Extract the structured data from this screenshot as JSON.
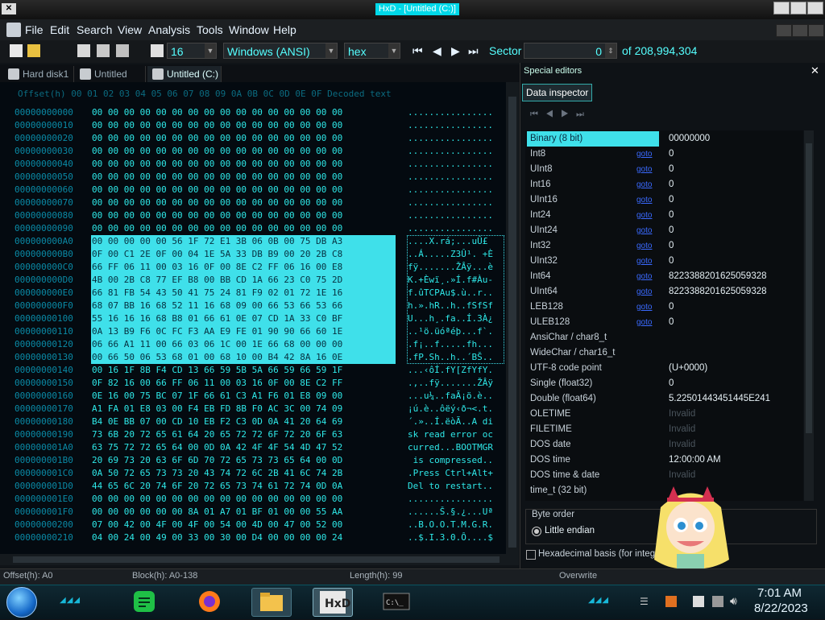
{
  "window": {
    "title": "HxD - [Untitled (C:)]",
    "app_icon": "hxd-icon"
  },
  "menu": {
    "items": [
      "File",
      "Edit",
      "Search",
      "View",
      "Analysis",
      "Tools",
      "Window",
      "Help"
    ]
  },
  "toolbar": {
    "bytes_per_row": "16",
    "encoding": "Windows (ANSI)",
    "display_mode": "hex",
    "sector_label": "Sector",
    "sector_value": "0",
    "sector_total": "of 208,994,304"
  },
  "tabs": [
    {
      "label": "Hard disk1",
      "active": false
    },
    {
      "label": "Untitled (C:)",
      "active": false
    },
    {
      "label": "Untitled (C:)",
      "active": true
    }
  ],
  "hex_view": {
    "header": "Offset(h)  00 01 02 03 04 05 06 07 08 09 0A 0B 0C 0D 0E 0F  Decoded text",
    "rows": [
      {
        "off": "00000000000",
        "hex": "00 00 00 00 00 00 00 00 00 00 00 00 00 00 00 00",
        "txt": "................",
        "sel": false
      },
      {
        "off": "00000000010",
        "hex": "00 00 00 00 00 00 00 00 00 00 00 00 00 00 00 00",
        "txt": "................",
        "sel": false
      },
      {
        "off": "00000000020",
        "hex": "00 00 00 00 00 00 00 00 00 00 00 00 00 00 00 00",
        "txt": "................",
        "sel": false
      },
      {
        "off": "00000000030",
        "hex": "00 00 00 00 00 00 00 00 00 00 00 00 00 00 00 00",
        "txt": "................",
        "sel": false
      },
      {
        "off": "00000000040",
        "hex": "00 00 00 00 00 00 00 00 00 00 00 00 00 00 00 00",
        "txt": "................",
        "sel": false
      },
      {
        "off": "00000000050",
        "hex": "00 00 00 00 00 00 00 00 00 00 00 00 00 00 00 00",
        "txt": "................",
        "sel": false
      },
      {
        "off": "00000000060",
        "hex": "00 00 00 00 00 00 00 00 00 00 00 00 00 00 00 00",
        "txt": "................",
        "sel": false
      },
      {
        "off": "00000000070",
        "hex": "00 00 00 00 00 00 00 00 00 00 00 00 00 00 00 00",
        "txt": "................",
        "sel": false
      },
      {
        "off": "00000000080",
        "hex": "00 00 00 00 00 00 00 00 00 00 00 00 00 00 00 00",
        "txt": "................",
        "sel": false
      },
      {
        "off": "00000000090",
        "hex": "00 00 00 00 00 00 00 00 00 00 00 00 00 00 00 00",
        "txt": "................",
        "sel": false
      },
      {
        "off": "000000000A0",
        "hex": "00 00 00 00 00 56 1F 72 E1 3B 06 0B 00 75 DB A3",
        "txt": "....X.rá;...uÛ£",
        "sel": true
      },
      {
        "off": "000000000B0",
        "hex": "0F 00 C1 2E 0F 00 04 1E 5A 33 DB B9 00 20 2B C8",
        "txt": "..Á.....Z3Û¹. +È",
        "sel": true
      },
      {
        "off": "000000000C0",
        "hex": "66 FF 06 11 00 03 16 0F 00 8E C2 FF 06 16 00 E8",
        "txt": "fÿ.......ŽÂÿ...è",
        "sel": true
      },
      {
        "off": "000000000D0",
        "hex": "4B 00 2B C8 77 EF B8 00 BB CD 1A 66 23 C0 75 2D",
        "txt": "K.+Èwï¸.»Í.f#Àu-",
        "sel": true
      },
      {
        "off": "000000000E0",
        "hex": "66 81 FB 54 43 50 41 75 24 81 F9 02 01 72 1E 16",
        "txt": "f.ûTCPAu$.ù..r..",
        "sel": true
      },
      {
        "off": "000000000F0",
        "hex": "68 07 BB 16 68 52 11 16 68 09 00 66 53 66 53 66",
        "txt": "h.».hR..h..fSfSf",
        "sel": true
      },
      {
        "off": "00000000100",
        "hex": "55 16 16 16 68 B8 01 66 61 0E 07 CD 1A 33 C0 BF",
        "txt": "U...h¸.fa..Í.3À¿",
        "sel": true
      },
      {
        "off": "00000000110",
        "hex": "0A 13 B9 F6 0C FC F3 AA E9 FE 01 90 90 66 60 1E",
        "txt": "..¹ö.üóªéþ...f`.",
        "sel": true
      },
      {
        "off": "00000000120",
        "hex": "06 66 A1 11 00 66 03 06 1C 00 1E 66 68 00 00 00",
        "txt": ".f¡..f.....fh...",
        "sel": true
      },
      {
        "off": "00000000130",
        "hex": "00 66 50 06 53 68 01 00 68 10 00 B4 42 8A 16 0E",
        "txt": ".fP.Sh..h..´BŠ..",
        "sel": true
      },
      {
        "off": "00000000140",
        "hex": "00 16 1F 8B F4 CD 13 66 59 5B 5A 66 59 66 59 1F",
        "txt": "...‹ôÍ.fY[ZfYfY.",
        "sel": false
      },
      {
        "off": "00000000150",
        "hex": "0F 82 16 00 66 FF 06 11 00 03 16 0F 00 8E C2 FF",
        "txt": ".,..fÿ.......ŽÂÿ",
        "sel": false
      },
      {
        "off": "00000000160",
        "hex": "0E 16 00 75 BC 07 1F 66 61 C3 A1 F6 01 E8 09 00",
        "txt": "...u¼..faÃ¡ö.è..",
        "sel": false
      },
      {
        "off": "00000000170",
        "hex": "A1 FA 01 E8 03 00 F4 EB FD 8B F0 AC 3C 00 74 09",
        "txt": "¡ú.è..ôëý‹ð¬<.t.",
        "sel": false
      },
      {
        "off": "00000000180",
        "hex": "B4 0E BB 07 00 CD 10 EB F2 C3 0D 0A 41 20 64 69",
        "txt": "´.»..Í.ëòÃ..A di",
        "sel": false
      },
      {
        "off": "00000000190",
        "hex": "73 6B 20 72 65 61 64 20 65 72 72 6F 72 20 6F 63",
        "txt": "sk read error oc",
        "sel": false
      },
      {
        "off": "000000001A0",
        "hex": "63 75 72 72 65 64 00 0D 0A 42 4F 4F 54 4D 47 52",
        "txt": "curred...BOOTMGR",
        "sel": false
      },
      {
        "off": "000000001B0",
        "hex": "20 69 73 20 63 6F 6D 70 72 65 73 73 65 64 00 0D",
        "txt": " is compressed..",
        "sel": false
      },
      {
        "off": "000000001C0",
        "hex": "0A 50 72 65 73 73 20 43 74 72 6C 2B 41 6C 74 2B",
        "txt": ".Press Ctrl+Alt+",
        "sel": false
      },
      {
        "off": "000000001D0",
        "hex": "44 65 6C 20 74 6F 20 72 65 73 74 61 72 74 0D 0A",
        "txt": "Del to restart..",
        "sel": false
      },
      {
        "off": "000000001E0",
        "hex": "00 00 00 00 00 00 00 00 00 00 00 00 00 00 00 00",
        "txt": "................",
        "sel": false
      },
      {
        "off": "000000001F0",
        "hex": "00 00 00 00 00 00 8A 01 A7 01 BF 01 00 00 55 AA",
        "txt": "......Š.§.¿...Uª",
        "sel": false
      },
      {
        "off": "00000000200",
        "hex": "07 00 42 00 4F 00 4F 00 54 00 4D 00 47 00 52 00",
        "txt": "..B.O.O.T.M.G.R.",
        "sel": false
      },
      {
        "off": "00000000210",
        "hex": "04 00 24 00 49 00 33 00 30 00 D4 00 00 00 00 24",
        "txt": "..$.I.3.0.Ô....$",
        "sel": false
      }
    ]
  },
  "special_editors": {
    "title": "Special editors",
    "tab": "Data inspector",
    "rows": [
      {
        "label": "Binary (8 bit)",
        "link": "",
        "value": "00000000",
        "invalid": false,
        "selected": true
      },
      {
        "label": "Int8",
        "link": "goto",
        "value": "0",
        "invalid": false,
        "selected": false
      },
      {
        "label": "UInt8",
        "link": "goto",
        "value": "0",
        "invalid": false,
        "selected": false
      },
      {
        "label": "Int16",
        "link": "goto",
        "value": "0",
        "invalid": false,
        "selected": false
      },
      {
        "label": "UInt16",
        "link": "goto",
        "value": "0",
        "invalid": false,
        "selected": false
      },
      {
        "label": "Int24",
        "link": "goto",
        "value": "0",
        "invalid": false,
        "selected": false
      },
      {
        "label": "UInt24",
        "link": "goto",
        "value": "0",
        "invalid": false,
        "selected": false
      },
      {
        "label": "Int32",
        "link": "goto",
        "value": "0",
        "invalid": false,
        "selected": false
      },
      {
        "label": "UInt32",
        "link": "goto",
        "value": "0",
        "invalid": false,
        "selected": false
      },
      {
        "label": "Int64",
        "link": "goto",
        "value": "8223388201625059328",
        "invalid": false,
        "selected": false
      },
      {
        "label": "UInt64",
        "link": "goto",
        "value": "8223388201625059328",
        "invalid": false,
        "selected": false
      },
      {
        "label": "LEB128",
        "link": "goto",
        "value": "0",
        "invalid": false,
        "selected": false
      },
      {
        "label": "ULEB128",
        "link": "goto",
        "value": "0",
        "invalid": false,
        "selected": false
      },
      {
        "label": "AnsiChar / char8_t",
        "link": "",
        "value": "",
        "invalid": false,
        "selected": false
      },
      {
        "label": "WideChar / char16_t",
        "link": "",
        "value": "",
        "invalid": false,
        "selected": false
      },
      {
        "label": "UTF-8 code point",
        "link": "",
        "value": "   (U+0000)",
        "invalid": false,
        "selected": false
      },
      {
        "label": "Single (float32)",
        "link": "",
        "value": "0",
        "invalid": false,
        "selected": false
      },
      {
        "label": "Double (float64)",
        "link": "",
        "value": "5.22501443451445E241",
        "invalid": false,
        "selected": false
      },
      {
        "label": "OLETIME",
        "link": "",
        "value": "Invalid",
        "invalid": true,
        "selected": false
      },
      {
        "label": "FILETIME",
        "link": "",
        "value": "Invalid",
        "invalid": true,
        "selected": false
      },
      {
        "label": "DOS date",
        "link": "",
        "value": "Invalid",
        "invalid": true,
        "selected": false
      },
      {
        "label": "DOS time",
        "link": "",
        "value": "12:00:00 AM",
        "invalid": false,
        "selected": false
      },
      {
        "label": "DOS time & date",
        "link": "",
        "value": "Invalid",
        "invalid": true,
        "selected": false
      },
      {
        "label": "time_t (32 bit)",
        "link": "",
        "value": "",
        "invalid": false,
        "selected": false
      }
    ],
    "byte_order_title": "Byte order",
    "little_endian": "Little endian",
    "hex_basis": "Hexadecimal basis (for integral numbers)"
  },
  "status": {
    "offset": "Offset(h): A0",
    "block": "Block(h): A0-138",
    "length": "Length(h): 99",
    "mode": "Overwrite"
  },
  "taskbar": {
    "time": "7:01 AM",
    "date": "8/22/2023"
  },
  "colors": {
    "accent": "#3fe0ea",
    "hex_text": "#2ee8e8",
    "background": "#040a10"
  }
}
